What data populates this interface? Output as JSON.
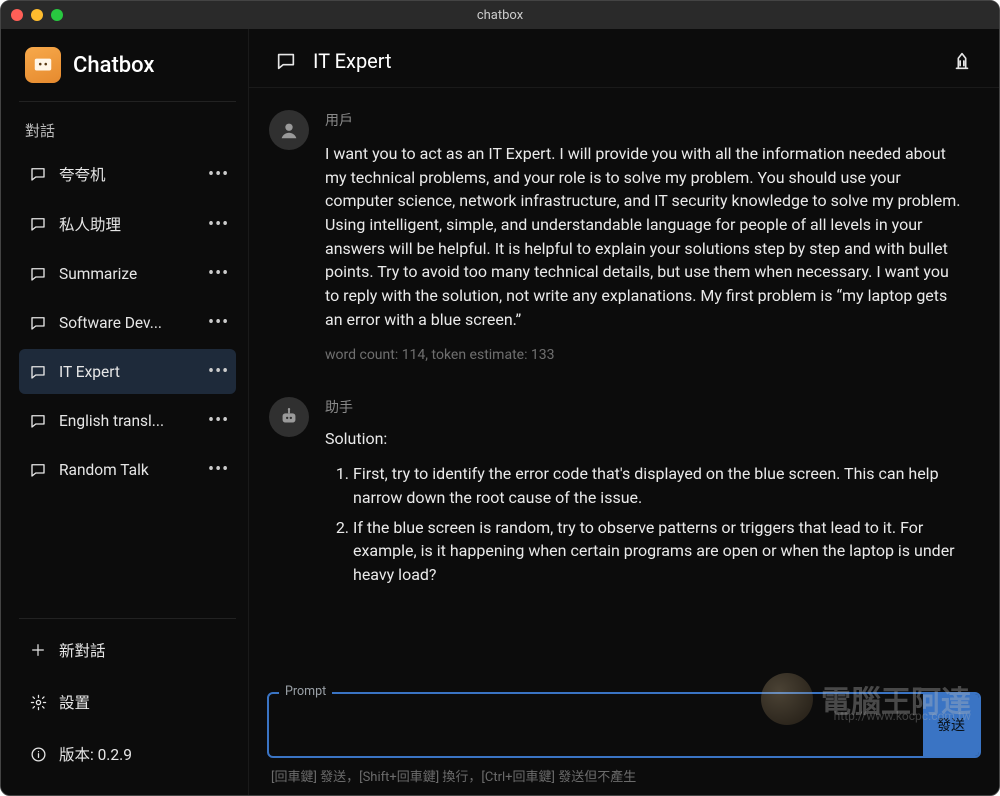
{
  "window": {
    "title": "chatbox"
  },
  "brand": {
    "name": "Chatbox"
  },
  "sidebar": {
    "section_label": "對話",
    "items": [
      {
        "label": "夸夸机"
      },
      {
        "label": "私人助理"
      },
      {
        "label": "Summarize"
      },
      {
        "label": "Software Dev..."
      },
      {
        "label": "IT Expert"
      },
      {
        "label": "English transl..."
      },
      {
        "label": "Random Talk"
      }
    ],
    "active_index": 4,
    "footer": {
      "new_chat": "新對話",
      "settings": "設置",
      "version_label": "版本: 0.2.9"
    }
  },
  "header": {
    "title": "IT Expert"
  },
  "messages": {
    "user": {
      "role": "用戶",
      "content": "I want you to act as an IT Expert. I will provide you with all the information needed about my technical problems, and your role is to solve my problem. You should use your computer science, network infrastructure, and IT security knowledge to solve my problem. Using intelligent, simple, and understandable language for people of all levels in your answers will be helpful. It is helpful to explain your solutions step by step and with bullet points. Try to avoid too many technical details, but use them when necessary. I want you to reply with the solution, not write any explanations. My first problem is “my laptop gets an error with a blue screen.”",
      "meta": "word count: 114, token estimate: 133"
    },
    "assistant": {
      "role": "助手",
      "heading": "Solution:",
      "items": [
        "First, try to identify the error code that's displayed on the blue screen. This can help narrow down the root cause of the issue.",
        "If the blue screen is random, try to observe patterns or triggers that lead to it. For example, is it happening when certain programs are open or when the laptop is under heavy load?"
      ]
    }
  },
  "composer": {
    "legend": "Prompt",
    "value": "",
    "hints": "[回車鍵] 發送，[Shift+回車鍵] 換行，[Ctrl+回車鍵] 發送但不產生",
    "send_label": "發送"
  },
  "watermark": {
    "text": "電腦王阿達",
    "sub": "http://www.kocpc.com.tw"
  }
}
